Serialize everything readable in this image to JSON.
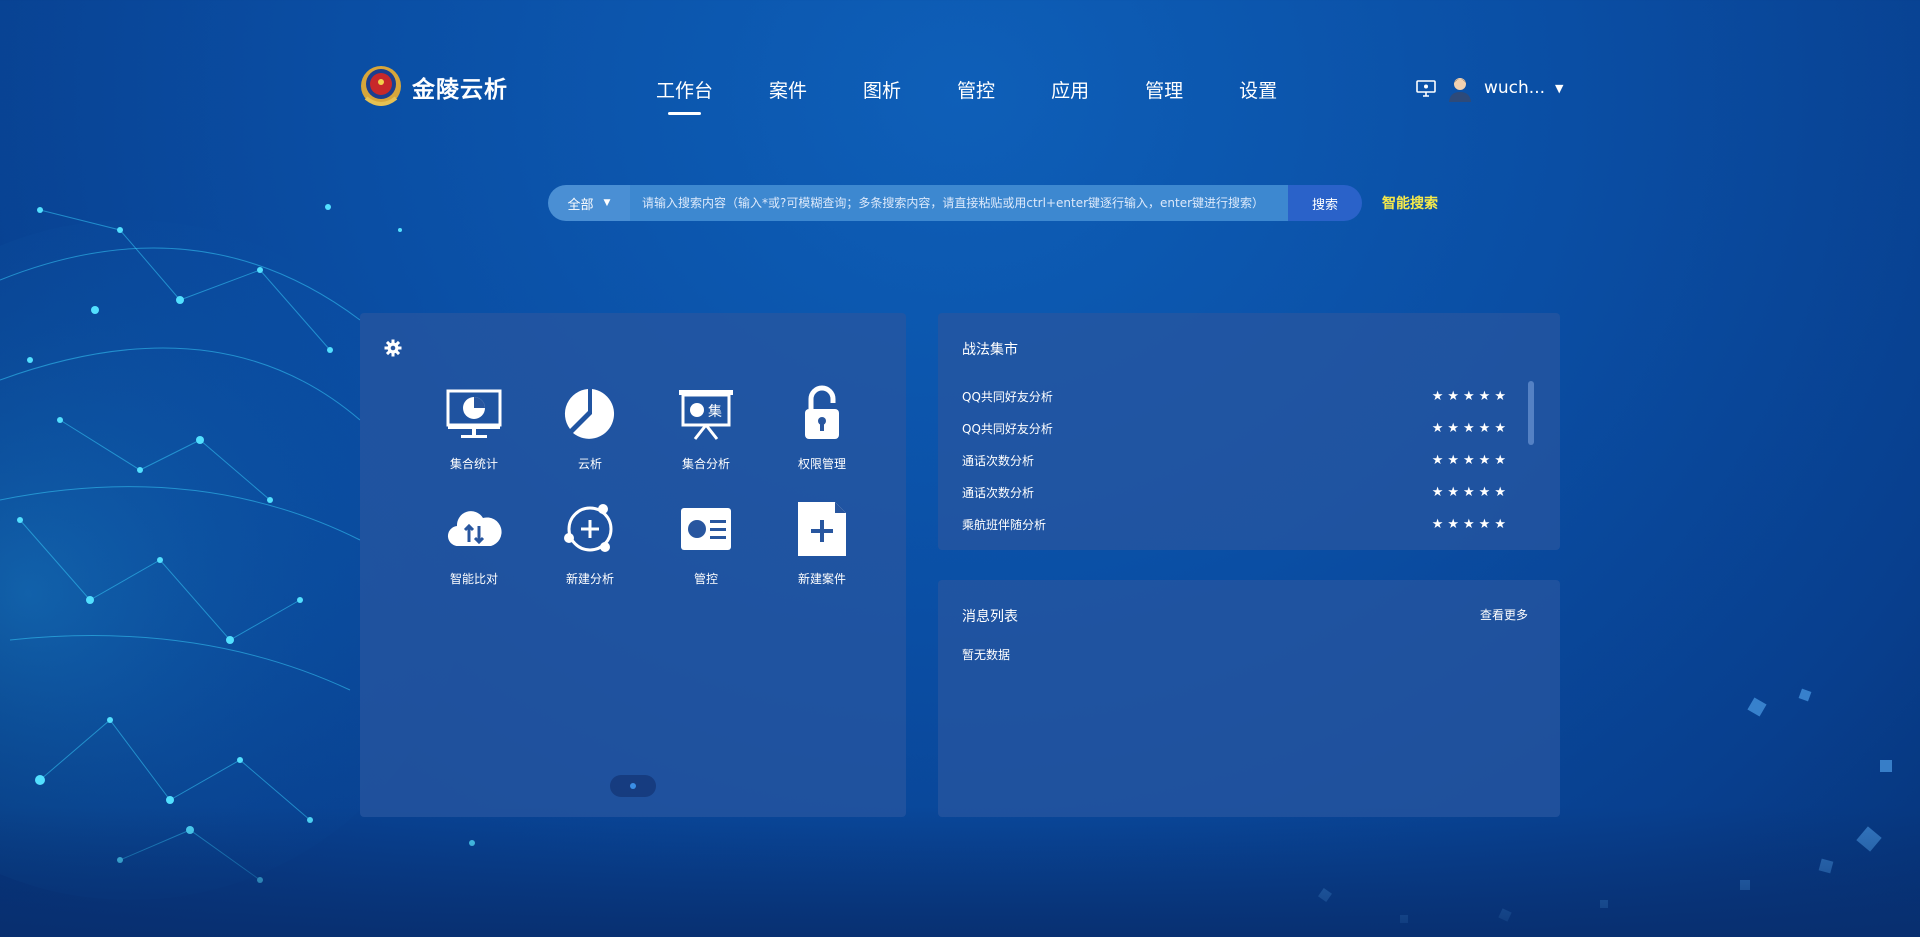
{
  "header": {
    "app_name": "金陵云析",
    "nav": [
      {
        "label": "工作台",
        "active": true
      },
      {
        "label": "案件"
      },
      {
        "label": "图析"
      },
      {
        "label": "管控"
      },
      {
        "label": "应用"
      },
      {
        "label": "管理"
      },
      {
        "label": "设置"
      }
    ],
    "username": "wuch...",
    "icons": {
      "monitor": "monitor-icon",
      "avatar": "user-avatar",
      "caret": "caret-down-icon"
    }
  },
  "search": {
    "scope_label": "全部",
    "placeholder": "请输入搜索内容（输入*或?可模糊查询；多条搜索内容，请直接粘贴或用ctrl+enter键逐行输入，enter键进行搜索）",
    "button_label": "搜索",
    "smart_label": "智能搜索"
  },
  "tools": [
    {
      "label": "集合统计",
      "icon": "monitor-chart-icon"
    },
    {
      "label": "云析",
      "icon": "pie-chart-icon"
    },
    {
      "label": "集合分析",
      "icon": "presentation-icon"
    },
    {
      "label": "权限管理",
      "icon": "lock-icon"
    },
    {
      "label": "智能比对",
      "icon": "cloud-compare-icon"
    },
    {
      "label": "新建分析",
      "icon": "new-analysis-icon"
    },
    {
      "label": "管控",
      "icon": "id-card-icon"
    },
    {
      "label": "新建案件",
      "icon": "new-file-icon"
    }
  ],
  "tactics": {
    "title": "战法集市",
    "items": [
      {
        "name": "QQ共同好友分析",
        "rating": "★★★★★"
      },
      {
        "name": "QQ共同好友分析",
        "rating": "★★★★★"
      },
      {
        "name": "通话次数分析",
        "rating": "★★★★★"
      },
      {
        "name": "通话次数分析",
        "rating": "★★★★★"
      },
      {
        "name": "乘航班伴随分析",
        "rating": "★★★★★"
      }
    ]
  },
  "messages": {
    "title": "消息列表",
    "more_label": "查看更多",
    "empty_text": "暂无数据"
  },
  "colors": {
    "background": "#0a4ea4",
    "panel": "#28569f",
    "search_button": "#2a62c9",
    "smart_search": "#f6e94a"
  }
}
